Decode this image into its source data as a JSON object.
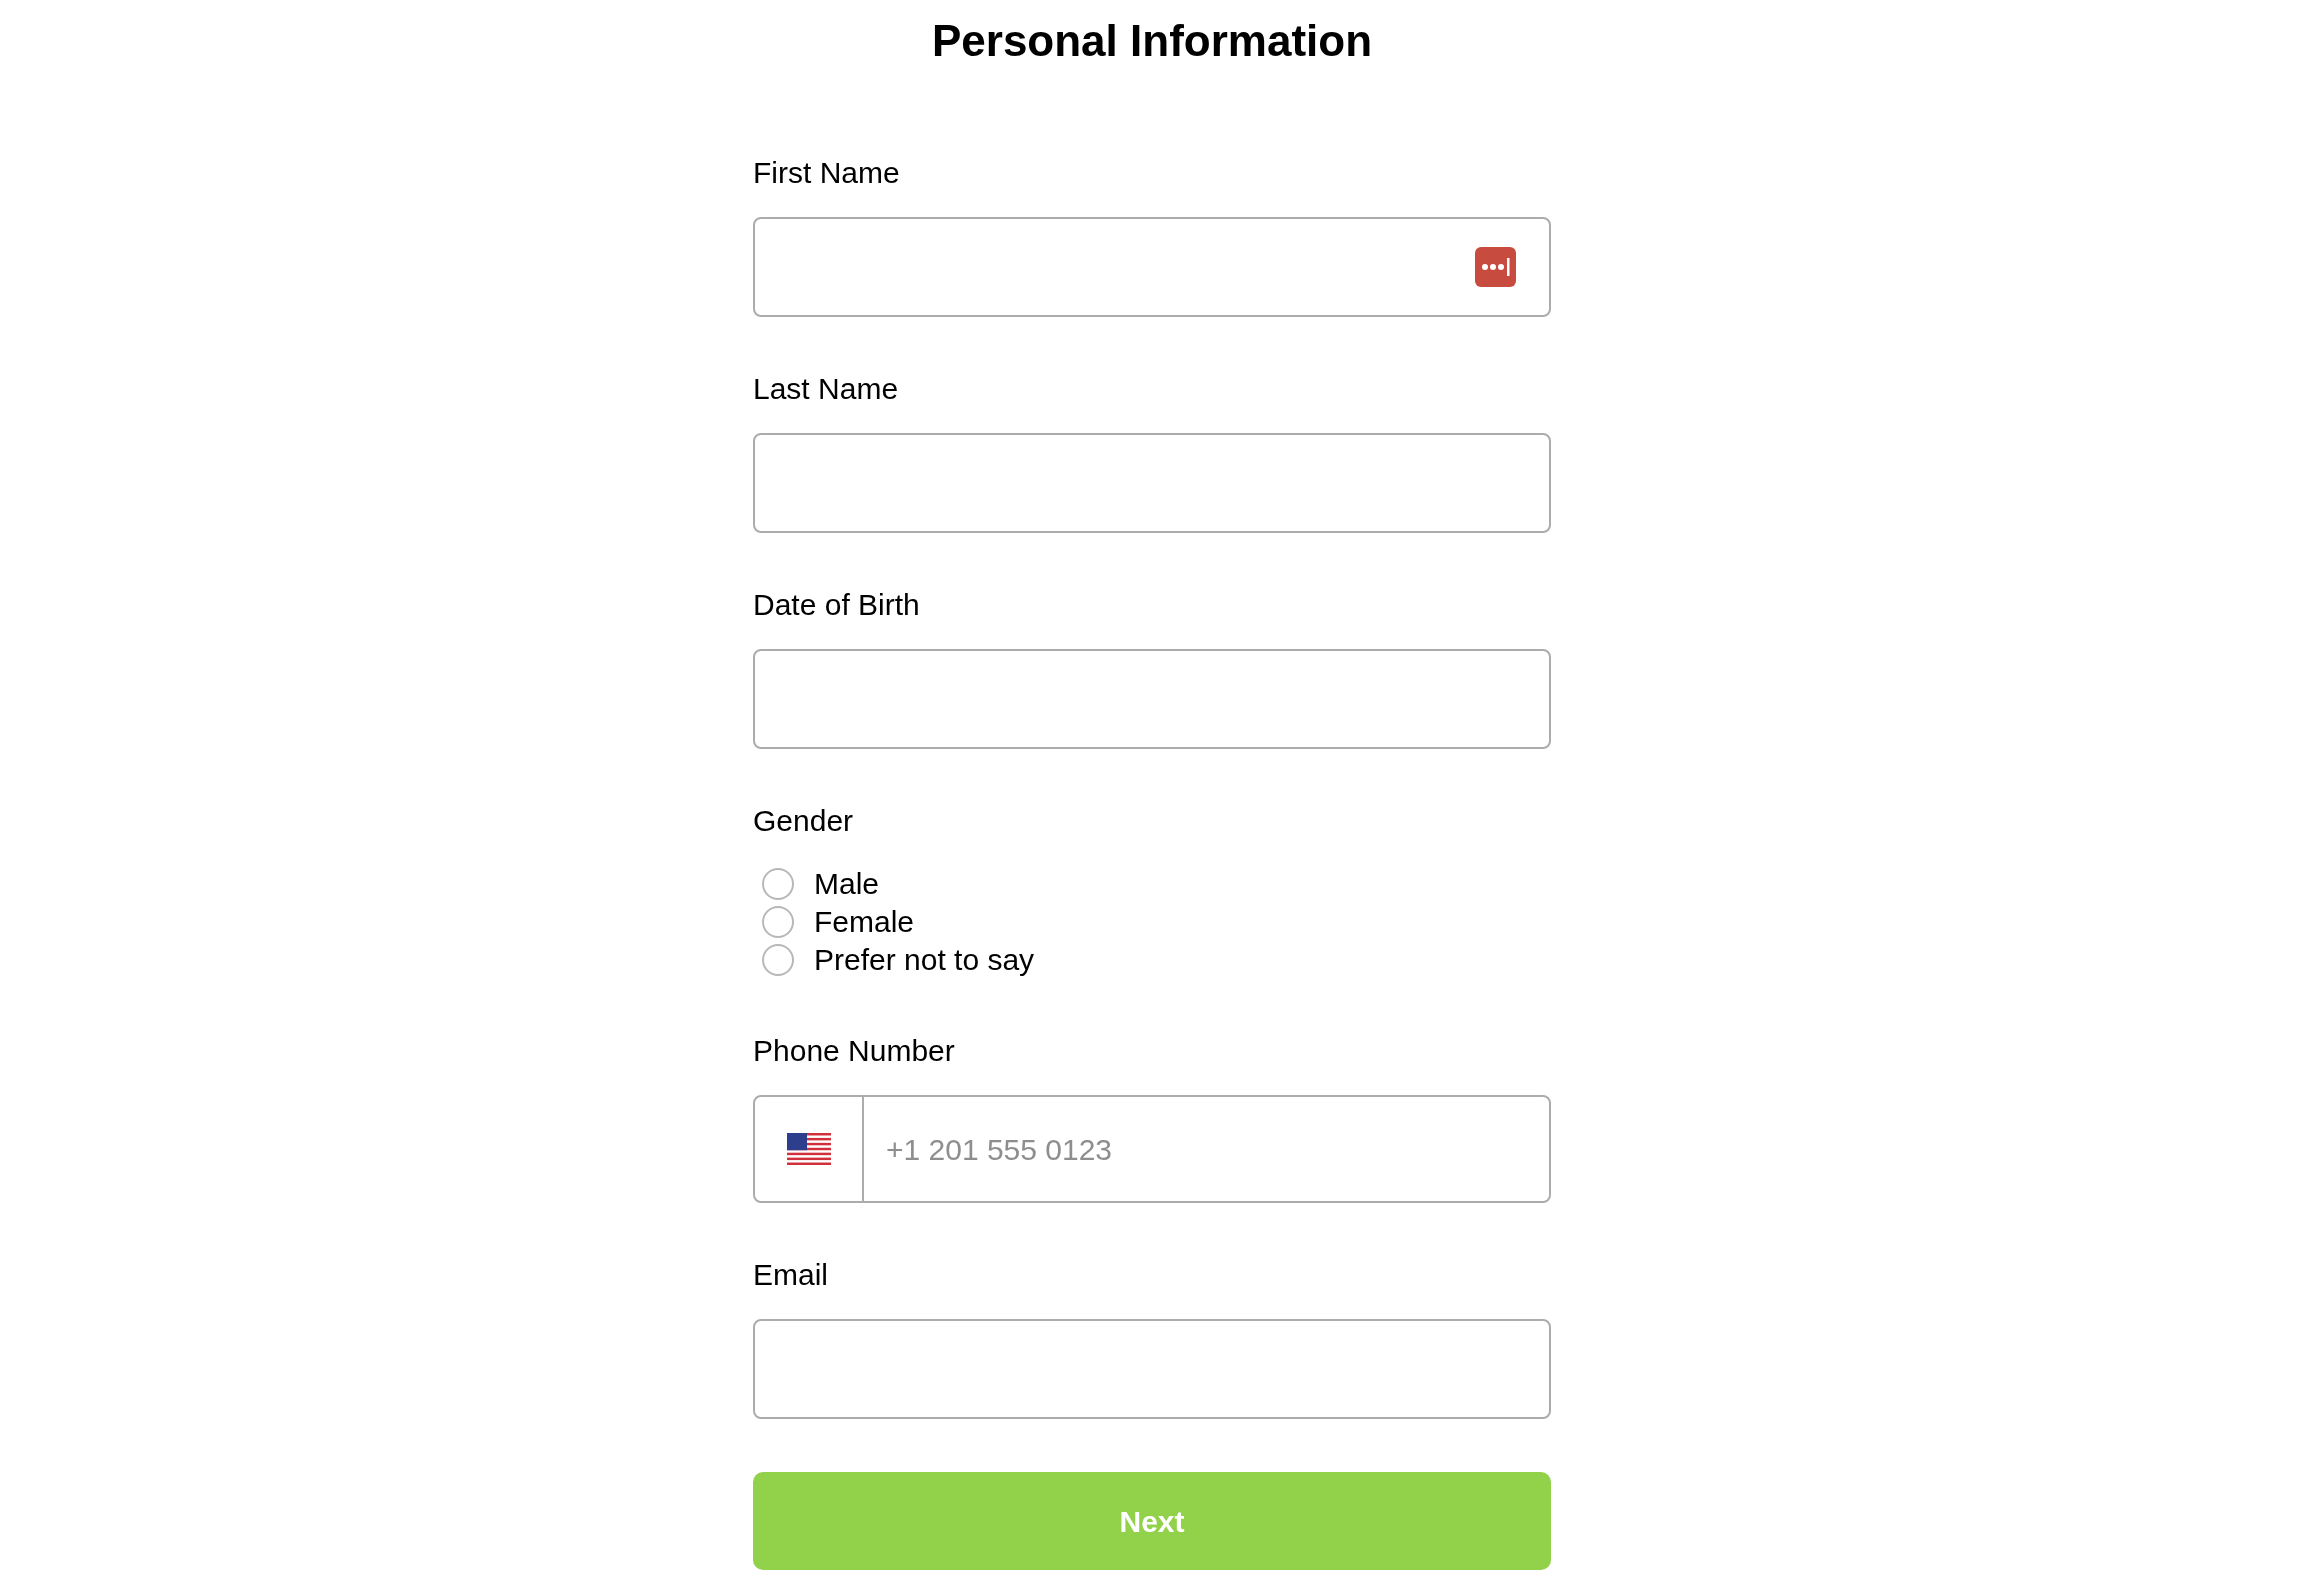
{
  "title": "Personal Information",
  "fields": [
    {
      "kind": "text",
      "label": "First Name",
      "autofill_icon": true
    },
    {
      "kind": "text",
      "label": "Last Name",
      "autofill_icon": false
    },
    {
      "kind": "text",
      "label": "Date of Birth",
      "autofill_icon": false
    },
    {
      "kind": "radio",
      "label": "Gender",
      "options": [
        {
          "label": "Male",
          "selected": false
        },
        {
          "label": "Female",
          "selected": false
        },
        {
          "label": "Prefer not to say",
          "selected": false
        }
      ]
    },
    {
      "kind": "phone",
      "label": "Phone Number",
      "placeholder": "+1 201 555 0123"
    },
    {
      "kind": "text",
      "label": "Email",
      "autofill_icon": false
    }
  ],
  "button": {
    "label": "Next"
  }
}
